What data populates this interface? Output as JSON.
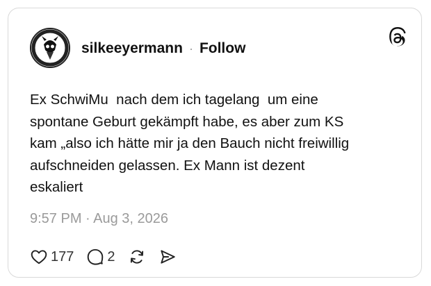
{
  "post": {
    "username": "silkeeyermann",
    "separator": "·",
    "follow_label": "Follow",
    "text": "Ex SchwiMu  nach dem ich tagelang  um eine\nspontane Geburt gekämpft habe, es aber zum KS\nkam „also ich hätte mir ja den Bauch nicht freiwillig\naufschneiden gelassen. Ex Mann ist dezent\neskaliert",
    "timestamp": "9:57 PM · Aug 3, 2026",
    "likes": "177",
    "replies": "2"
  },
  "icons": {
    "brand": "threads-logo-icon",
    "avatar": "avatar-image",
    "like": "heart-icon",
    "reply": "comment-icon",
    "repost": "repost-icon",
    "share": "share-icon"
  },
  "colors": {
    "text": "#111111",
    "muted": "#9a9a9a",
    "border": "#d9d9d9"
  }
}
